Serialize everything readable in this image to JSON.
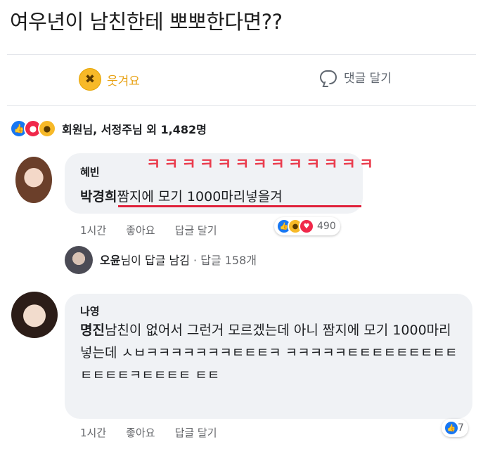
{
  "post": {
    "title": "여우년이 남친한테 뽀뽀한다면??"
  },
  "actions": {
    "laugh_label": "웃겨요",
    "comment_label": "댓글 달기"
  },
  "reactions_summary": {
    "text": "회원님, 서정주님 외 1,482명"
  },
  "comments": [
    {
      "author": "혜빈",
      "highlight": "박경희",
      "text": "짬지에 모기 1000마리넣을겨",
      "overlay_text": "ㅋㅋㅋㅋㅋㅋㅋㅋㅋㅋㅋㅋㅋ",
      "time": "1시간",
      "like_label": "좋아요",
      "reply_label": "답글 달기",
      "reaction_count": "490",
      "reply_summary": {
        "author": "오윤",
        "text": "님이 답글 남김",
        "count": "· 답글 158개"
      }
    },
    {
      "author": "나영",
      "highlight": "명진",
      "text": "남친이 없어서 그런거 모르겠는데 아니 짬지에 모기 1000마리 넣는데 ㅅㅂㅋㅋㅋㅋㅋㅋㅋㅌㅌㅌㅋ ㅋㅋㅋㅋㅋㅌㅌㅌㅌㅌㅌㅌㅌㅌㅌㅌㅌㅌㅋㅌㅌㅌㅌ ㅌㅌ",
      "time": "1시간",
      "like_label": "좋아요",
      "reply_label": "답글 달기",
      "reaction_count": "7"
    }
  ],
  "colors": {
    "accent": "#1877f2",
    "laugh": "#f7b928",
    "annotation_red": "#e0203a"
  }
}
